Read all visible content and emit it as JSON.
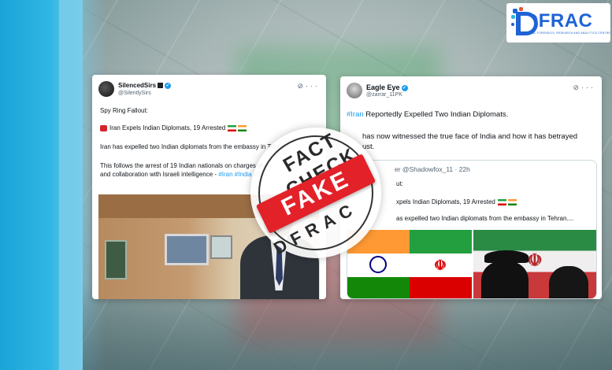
{
  "brand": {
    "name": "DFRAC",
    "subtitle": "DIGITAL FORENSICS, RESEARCH AND ANALYTICS CENTRE"
  },
  "stamp": {
    "top_text": "FACT CHECK",
    "banner": "FAKE",
    "bottom_text": "DFRAC"
  },
  "tweet_left": {
    "name": "SilencedSirs",
    "handle": "@SilentlySirs",
    "line1": "Spy Ring Fallout:",
    "line2": "Iran Expels Indian Diplomats, 19 Arrested",
    "line3": "Iran has expelled two Indian diplomats from the embassy in Tehra",
    "line4": "This follows the arrest of 19 Indian nationals on charges of es",
    "line5a": "and collaboration with Israeli intelligence - ",
    "line5b": "#Iran #India #Isr"
  },
  "tweet_right": {
    "name": "Eagle Eye",
    "handle": "@zarrar_11PK",
    "hashtag": "#Iran",
    "line1": " Reportedly Expelled Two Indian Diplomats.",
    "line2": "has now witnessed the true face of India and how it has betrayed",
    "line3": "ust.",
    "quote": {
      "header": "er @Shadowfox_11 · 22h",
      "line0": "ut:",
      "line1": "xpels Indian Diplomats, 19 Arrested",
      "line2": "as expelled two Indian diplomats from the embassy in Tehran...."
    }
  },
  "colors": {
    "brand_blue": "#1f63d6",
    "fake_red": "#e32129",
    "twitter_blue": "#1d9bf0"
  }
}
